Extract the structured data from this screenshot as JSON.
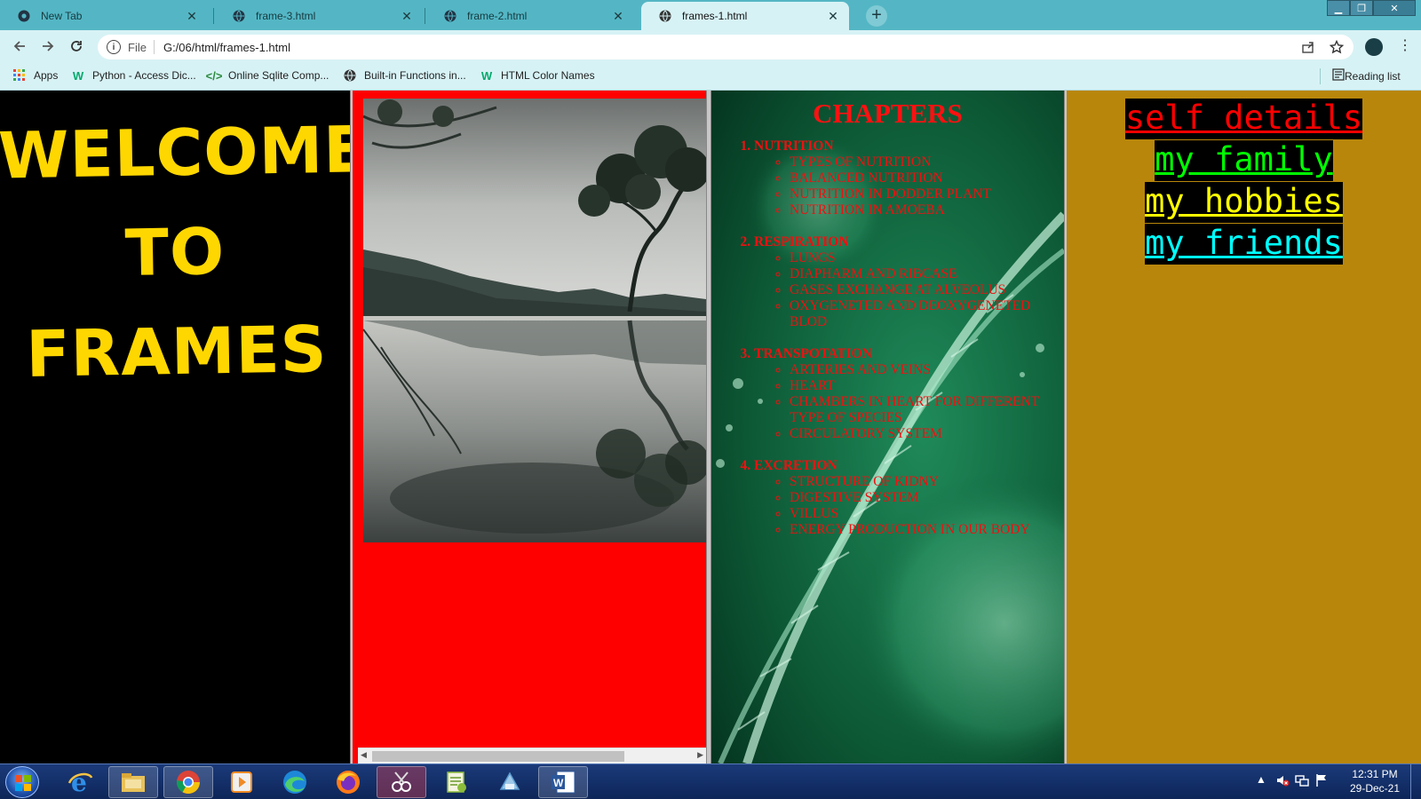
{
  "browser": {
    "tabs": [
      {
        "title": "New Tab",
        "icon": "chrome-icon"
      },
      {
        "title": "frame-3.html",
        "icon": "globe-icon"
      },
      {
        "title": "frame-2.html",
        "icon": "globe-icon"
      },
      {
        "title": "frames-1.html",
        "icon": "globe-icon",
        "active": true
      }
    ],
    "address": {
      "scheme": "File",
      "url": "G:/06/html/frames-1.html"
    },
    "bookmarks": [
      {
        "label": "Apps",
        "icon": "apps-grid-icon"
      },
      {
        "label": "Python - Access Dic...",
        "icon": "w3schools-icon"
      },
      {
        "label": "Online Sqlite Comp...",
        "icon": "code-icon"
      },
      {
        "label": "Built-in Functions in...",
        "icon": "globe-icon"
      },
      {
        "label": "HTML Color Names",
        "icon": "w3schools-icon"
      }
    ],
    "reading_list": "Reading list"
  },
  "frame1": {
    "welcome_line1": "WELCOME",
    "welcome_line2": "TO FRAMES",
    "color": "#ffd700"
  },
  "frame3": {
    "heading": "CHAPTERS",
    "chapters": [
      {
        "title": "NUTRITION",
        "items": [
          "TYPES OF NUTRITION",
          "BALANCED NUTRITION",
          "NUTRITION IN DODDER PLANT",
          "NUTRITION IN AMOEBA"
        ]
      },
      {
        "title": "RESPIRATION",
        "items": [
          "LUNGS",
          "DIAPHARM AND RIBCASE",
          "GASES EXCHANGE AT ALVEOLUS",
          "OXYGENETED AND DEOXYGENETED BLOD"
        ]
      },
      {
        "title": "TRANSPOTATION",
        "items": [
          "ARTERIES AND VEINS",
          "HEART",
          "CHAMBERS IN HEART FOR DIFFERENT TYPE OF SPECIES",
          "CIRCULATORY SYSTEM"
        ]
      },
      {
        "title": "EXCRETION",
        "items": [
          "STRUCTURE OF KIDNY",
          "DIGESTIVE SYSTEM",
          "VILLUS",
          "ENERGY PRODUCTION IN OUR BODY"
        ]
      }
    ]
  },
  "frame4": {
    "links": [
      {
        "label": "self details",
        "color": "#ff0000"
      },
      {
        "label": "my family",
        "color": "#00ff00"
      },
      {
        "label": "my hobbies",
        "color": "#ffff00"
      },
      {
        "label": "my friends",
        "color": "#00ffff"
      }
    ]
  },
  "taskbar": {
    "time": "12:31 PM",
    "date": "29-Dec-21"
  }
}
